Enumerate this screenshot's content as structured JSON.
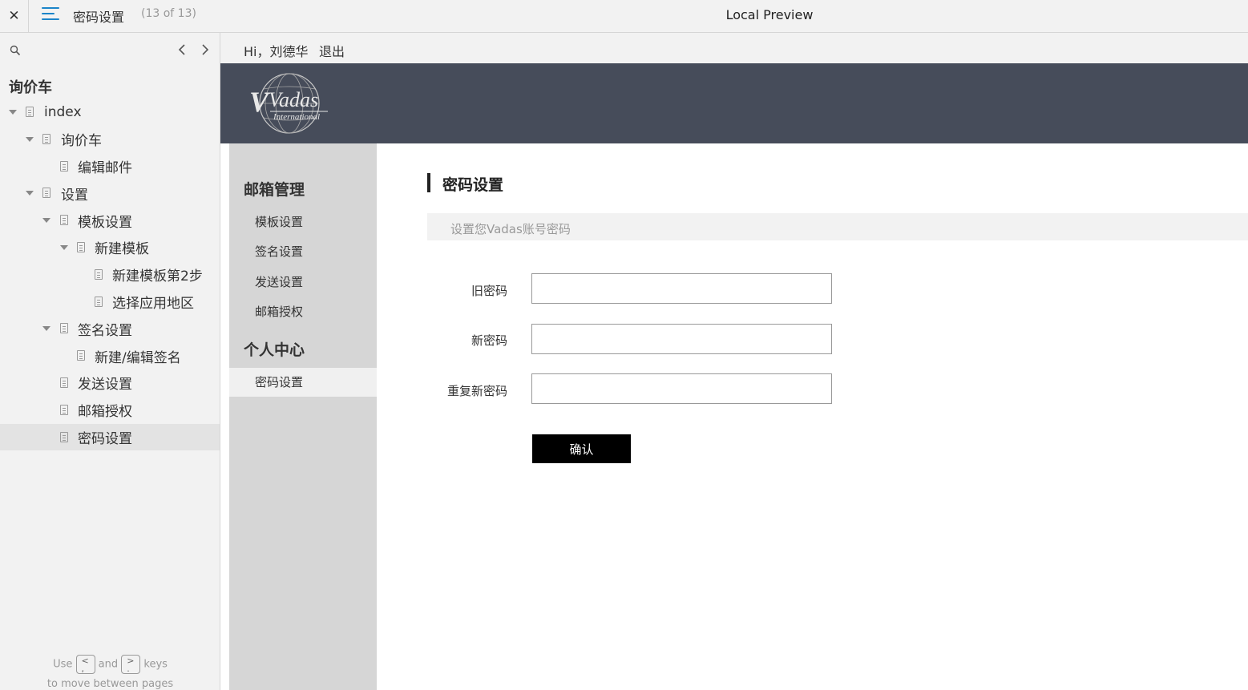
{
  "topbar": {
    "close_icon": "close-icon",
    "menu_icon": "menu-icon",
    "page_title": "密码设置",
    "page_count": "(13 of 13)",
    "preview_title": "Local Preview"
  },
  "sidebar": {
    "root": "询价车",
    "items": [
      {
        "label": "index"
      },
      {
        "label": "询价车"
      },
      {
        "label": "编辑邮件"
      },
      {
        "label": "设置"
      },
      {
        "label": "模板设置"
      },
      {
        "label": "新建模板"
      },
      {
        "label": "新建模板第2步"
      },
      {
        "label": "选择应用地区"
      },
      {
        "label": "签名设置"
      },
      {
        "label": "新建/编辑签名"
      },
      {
        "label": "发送设置"
      },
      {
        "label": "邮箱授权"
      },
      {
        "label": "密码设置"
      }
    ],
    "hint": {
      "use": "Use",
      "and": "and",
      "keys": "keys",
      "line2": "to move between pages",
      "prev_key": "<",
      "next_key": ">"
    }
  },
  "app": {
    "greeting": "Hi，刘德华",
    "logout": "退出",
    "logo_text": "Vadas",
    "logo_subtext": "International",
    "nav": {
      "section1": "邮箱管理",
      "section1_items": [
        "模板设置",
        "签名设置",
        "发送设置",
        "邮箱授权"
      ],
      "section2": "个人中心",
      "section2_items": [
        "密码设置"
      ]
    },
    "content": {
      "title": "密码设置",
      "subtitle": "设置您Vadas账号密码",
      "old_password_label": "旧密码",
      "new_password_label": "新密码",
      "repeat_password_label": "重复新密码",
      "old_password_value": "",
      "new_password_value": "",
      "repeat_password_value": "",
      "confirm_label": "确认"
    }
  }
}
